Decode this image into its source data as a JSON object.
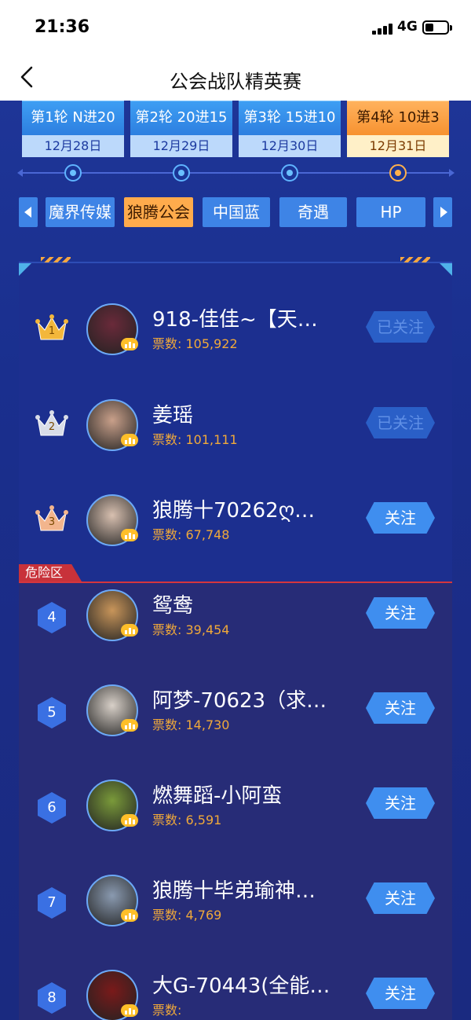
{
  "status_bar": {
    "time": "21:36",
    "network": "4G"
  },
  "nav": {
    "title": "公会战队精英赛"
  },
  "rounds": [
    {
      "label": "第1轮 N进20",
      "date": "12月28日"
    },
    {
      "label": "第2轮 20进15",
      "date": "12月29日"
    },
    {
      "label": "第3轮 15进10",
      "date": "12月30日"
    },
    {
      "label": "第4轮 10进3",
      "date": "12月31日"
    }
  ],
  "active_round_index": 3,
  "guild_tabs": [
    "魔界传媒",
    "狼腾公会",
    "中国蓝",
    "奇遇",
    "HP"
  ],
  "active_guild_index": 1,
  "danger_label": "危险区",
  "votes_prefix": "票数:",
  "ranking": [
    {
      "rank": "1",
      "name": "918-佳佳~【天…",
      "votes": "105,922",
      "follow": "已关注",
      "followed": true
    },
    {
      "rank": "2",
      "name": "姜瑶",
      "votes": "101,111",
      "follow": "已关注",
      "followed": true
    },
    {
      "rank": "3",
      "name": "狼腾十70262ღ…",
      "votes": "67,748",
      "follow": "关注",
      "followed": false
    },
    {
      "rank": "4",
      "name": "鸳鸯",
      "votes": "39,454",
      "follow": "关注",
      "followed": false
    },
    {
      "rank": "5",
      "name": "阿梦-70623（求…",
      "votes": "14,730",
      "follow": "关注",
      "followed": false
    },
    {
      "rank": "6",
      "name": "燃舞蹈-小阿蛮",
      "votes": "6,591",
      "follow": "关注",
      "followed": false
    },
    {
      "rank": "7",
      "name": "狼腾十毕弟瑜神…",
      "votes": "4,769",
      "follow": "关注",
      "followed": false
    },
    {
      "rank": "8",
      "name": "大G-70443(全能…",
      "votes": "",
      "follow": "关注",
      "followed": false
    }
  ],
  "colors": {
    "accent_orange": "#ffab4c",
    "accent_blue": "#3e84e6",
    "danger_red": "#d4363e",
    "votes_gold": "#f0a93a"
  }
}
